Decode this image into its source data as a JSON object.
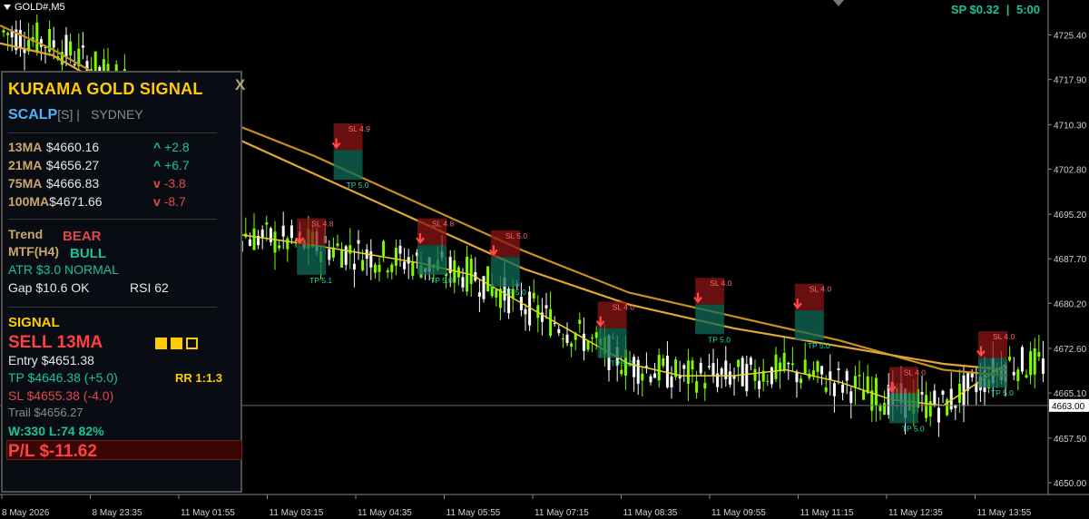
{
  "window": {
    "symbol": "GOLD#,M5"
  },
  "header": {
    "spread": "SP $0.32",
    "separator": "|",
    "timer": "5:00"
  },
  "panel": {
    "title": "KURAMA GOLD SIGNAL",
    "close": "X",
    "mode": "SCALP",
    "mode_tag": "[S] |",
    "session": "SYDNEY",
    "mas": [
      {
        "name": "13MA",
        "value": "$4660.16",
        "dir": "^",
        "change": "+2.8",
        "trend": "up"
      },
      {
        "name": "21MA",
        "value": "$4656.27",
        "dir": "^",
        "change": "+6.7",
        "trend": "up"
      },
      {
        "name": "75MA",
        "value": "$4666.83",
        "dir": "v",
        "change": "-3.8",
        "trend": "down"
      },
      {
        "name": "100MA",
        "value": "$4671.66",
        "dir": "v",
        "change": "-8.7",
        "trend": "down"
      }
    ],
    "trend_label": "Trend",
    "trend_value": "BEAR",
    "mtf_label": "MTF(H4)",
    "mtf_value": "BULL",
    "atr_line": "ATR  $3.0  NORMAL",
    "gap_line": "Gap $10.6 OK",
    "rsi": "RSI 62",
    "signal_label": "SIGNAL",
    "signal_value": "SELL  13MA",
    "entry": "Entry  $4651.38",
    "tp": "TP  $4646.38  (+5.0)",
    "rr": "RR 1:1.3",
    "sl": "SL  $4655.38  (-4.0)",
    "trail": "Trail  $4656.27",
    "winloss": "W:330 L:74  82%",
    "pl": "P/L  $-11.62",
    "colors": {
      "gold": "#ffcc00",
      "bull": "#19c39a",
      "bear": "#e04848",
      "scalp": "#4fb3ff"
    }
  },
  "chart_data": {
    "type": "line",
    "title": "",
    "ylim": [
      4648,
      4729
    ],
    "y_ticks": [
      "4725.40",
      "4717.90",
      "4710.30",
      "4702.80",
      "4695.20",
      "4687.70",
      "4680.20",
      "4672.60",
      "4665.10",
      "4657.50",
      "4650.00"
    ],
    "y_tick_values": [
      4725.4,
      4717.9,
      4710.3,
      4702.8,
      4695.2,
      4687.7,
      4680.2,
      4672.6,
      4665.1,
      4657.5,
      4650.0
    ],
    "x_ticks": [
      "8 May 2026",
      "8 May 23:35",
      "11 May 01:55",
      "11 May 03:15",
      "11 May 04:35",
      "11 May 05:55",
      "11 May 07:15",
      "11 May 08:35",
      "11 May 09:55",
      "11 May 11:15",
      "11 May 12:35",
      "11 May 13:55"
    ],
    "current_price": "4663.00",
    "current_price_value": 4663.0,
    "series": [
      {
        "name": "",
        "color": "#c8901e",
        "role": "ma-slow",
        "x": [
          0,
          0.05,
          0.1,
          0.2,
          0.3,
          0.4,
          0.5,
          0.6,
          0.7,
          0.8,
          0.9,
          0.96
        ],
        "values": [
          4727,
          4723,
          4718,
          4712,
          4705,
          4697,
          4689,
          4682,
          4678,
          4674,
          4669,
          4668
        ]
      },
      {
        "name": "",
        "color": "#e0a830",
        "role": "ma-slow2",
        "x": [
          0,
          0.05,
          0.1,
          0.2,
          0.3,
          0.4,
          0.5,
          0.6,
          0.7,
          0.8,
          0.9,
          0.96
        ],
        "values": [
          4724,
          4722,
          4717,
          4710,
          4702,
          4694,
          4686,
          4680,
          4676,
          4673,
          4670,
          4669
        ]
      },
      {
        "name": "",
        "color": "#e8d820",
        "role": "ma-fast",
        "x": [
          0.22,
          0.3,
          0.4,
          0.45,
          0.5,
          0.55,
          0.6,
          0.65,
          0.7,
          0.75,
          0.8,
          0.85,
          0.9,
          0.96
        ],
        "values": [
          4692,
          4690,
          4687,
          4685,
          4680,
          4675,
          4670,
          4668,
          4668,
          4669,
          4667,
          4664,
          4663,
          4670
        ]
      }
    ],
    "signals": [
      {
        "x": "11 May 03:15",
        "xf": 0.285,
        "entry": 4690,
        "sl_label": "SL 4.8",
        "tp_label": "TP 5.1"
      },
      {
        "x": "11 May 04:35",
        "xf": 0.32,
        "entry": 4706,
        "sl_label": "SL 4.9",
        "tp_label": "TP 5.0"
      },
      {
        "x": "11 May 04:35",
        "xf": 0.4,
        "entry": 4690,
        "sl_label": "SL 4.8",
        "tp_label": "TP 5.0"
      },
      {
        "x": "11 May 05:55",
        "xf": 0.47,
        "entry": 4688,
        "sl_label": "SL 5.0",
        "tp_label": "TP 5.0"
      },
      {
        "x": "11 May 07:15",
        "xf": 0.572,
        "entry": 4676,
        "sl_label": "SL 4.0",
        "tp_label": "TP 5.0"
      },
      {
        "x": "11 May 08:35",
        "xf": 0.665,
        "entry": 4680,
        "sl_label": "SL 4.0",
        "tp_label": "TP 5.0"
      },
      {
        "x": "11 May 09:55",
        "xf": 0.76,
        "entry": 4679,
        "sl_label": "SL 4.0",
        "tp_label": "TP 5.0"
      },
      {
        "x": "11 May 12:35",
        "xf": 0.85,
        "entry": 4665,
        "sl_label": "SL 4.0",
        "tp_label": "TP 5.0"
      },
      {
        "x": "11 May 13:55",
        "xf": 0.935,
        "entry": 4671,
        "sl_label": "SL 4.0",
        "tp_label": "TP 5.0"
      }
    ],
    "grid": false,
    "colors": {
      "bull_candle": "#7cfc00",
      "bear_candle": "#ffffff",
      "background": "#000000",
      "axis": "#888888"
    }
  }
}
